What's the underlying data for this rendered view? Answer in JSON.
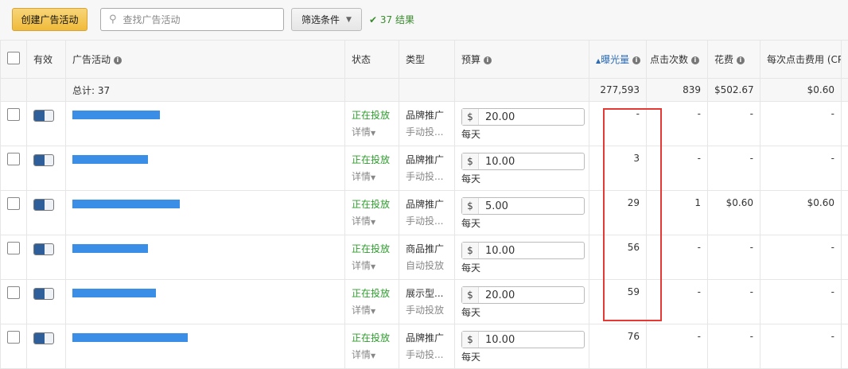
{
  "toolbar": {
    "create_label": "创建广告活动",
    "search_placeholder": "查找广告活动",
    "search_icon": "search-icon",
    "filter_label": "筛选条件",
    "result_text": "37 结果"
  },
  "columns": {
    "active": "有效",
    "campaign": "广告活动",
    "status": "状态",
    "type": "类型",
    "budget": "预算",
    "impressions": "曝光量",
    "clicks": "点击次数",
    "spend": "花费",
    "cpc": "每次点击费用 (CPC)"
  },
  "totals": {
    "label": "总计: 37",
    "impressions": "277,593",
    "clicks": "839",
    "spend": "$502.67",
    "cpc": "$0.60"
  },
  "rows": [
    {
      "status": "正在投放",
      "details": "详情",
      "type": "品牌推广",
      "targeting": "手动投...",
      "currency": "$",
      "budget": "20.00",
      "period": "每天",
      "impressions": "-",
      "clicks": "-",
      "spend": "-",
      "cpc": "-"
    },
    {
      "status": "正在投放",
      "details": "详情",
      "type": "品牌推广",
      "targeting": "手动投...",
      "currency": "$",
      "budget": "10.00",
      "period": "每天",
      "impressions": "3",
      "clicks": "-",
      "spend": "-",
      "cpc": "-"
    },
    {
      "status": "正在投放",
      "details": "详情",
      "type": "品牌推广",
      "targeting": "手动投...",
      "currency": "$",
      "budget": "5.00",
      "period": "每天",
      "impressions": "29",
      "clicks": "1",
      "spend": "$0.60",
      "cpc": "$0.60"
    },
    {
      "status": "正在投放",
      "details": "详情",
      "type": "商品推广",
      "targeting": "自动投放",
      "currency": "$",
      "budget": "10.00",
      "period": "每天",
      "impressions": "56",
      "clicks": "-",
      "spend": "-",
      "cpc": "-"
    },
    {
      "status": "正在投放",
      "details": "详情",
      "type": "展示型...",
      "targeting": "手动投放",
      "currency": "$",
      "budget": "20.00",
      "period": "每天",
      "impressions": "59",
      "clicks": "-",
      "spend": "-",
      "cpc": "-"
    },
    {
      "status": "正在投放",
      "details": "详情",
      "type": "品牌推广",
      "targeting": "手动投...",
      "currency": "$",
      "budget": "10.00",
      "period": "每天",
      "impressions": "76",
      "clicks": "-",
      "spend": "-",
      "cpc": "-"
    }
  ],
  "colors": {
    "accent": "#f0bb3a",
    "status_green": "#2e9d2e",
    "sorted": "#2e6db4",
    "highlight": "#e53935"
  }
}
